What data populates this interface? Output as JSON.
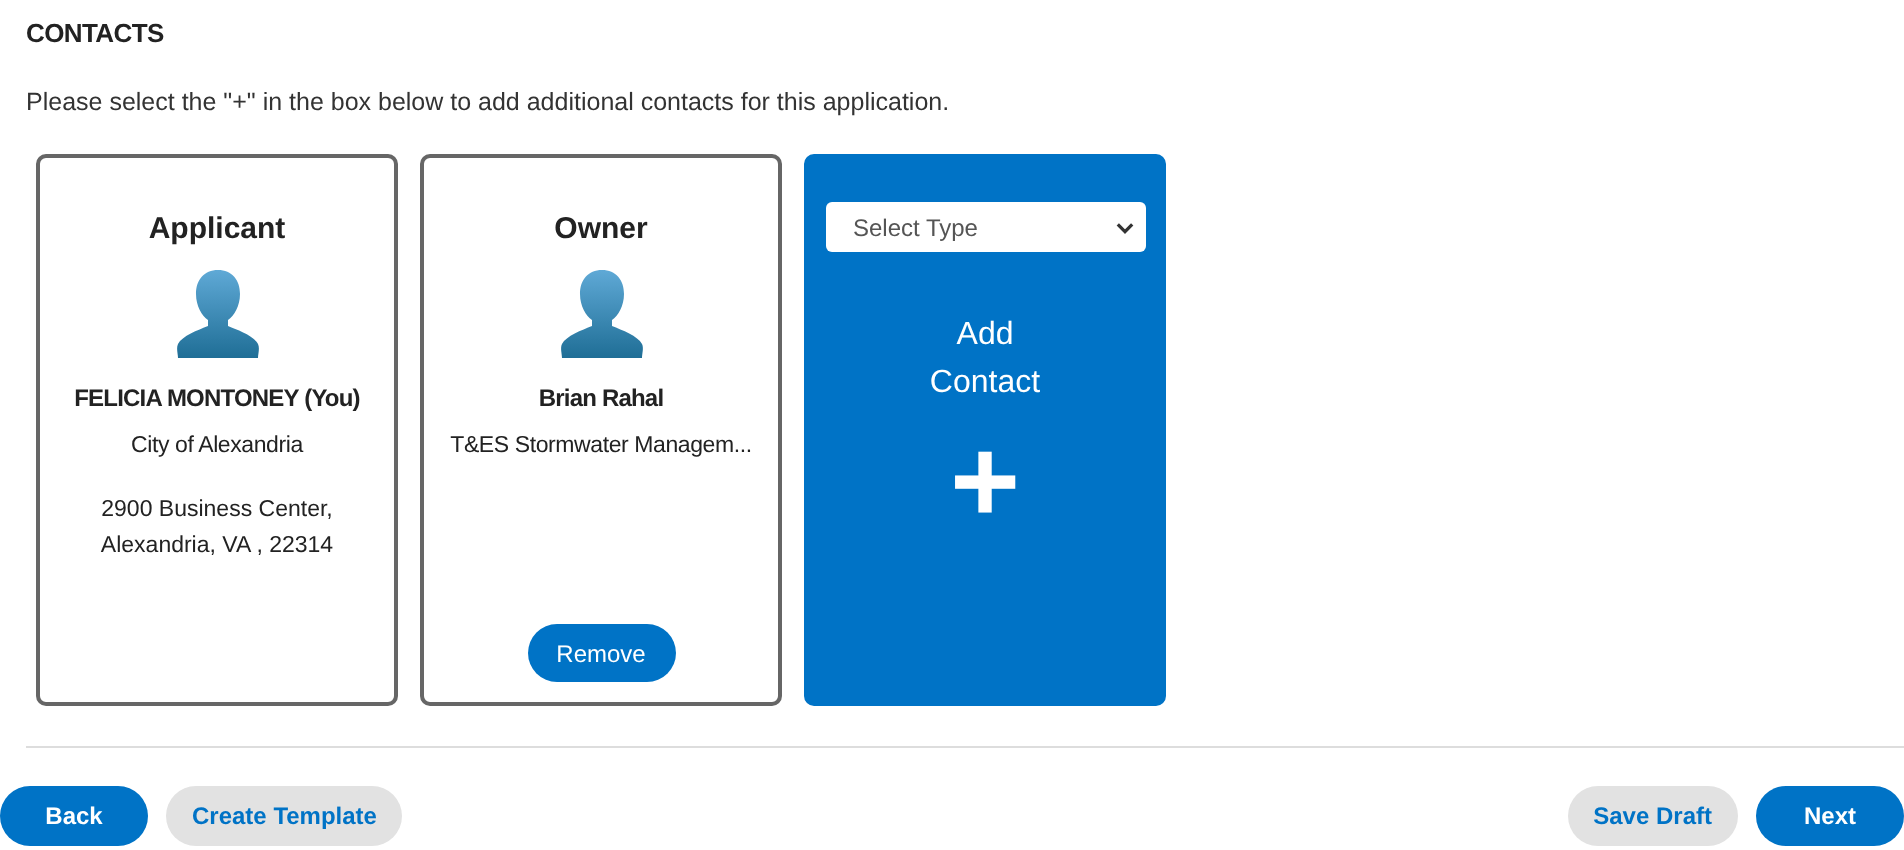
{
  "section_title": "CONTACTS",
  "instruction": "Please select the \"+\" in the box below to add additional contacts for this application.",
  "cards": [
    {
      "kind": "contact",
      "role": "Applicant",
      "name": "FELICIA MONTONEY (You)",
      "organization": "City of Alexandria",
      "address": [
        "2900 Business Center,",
        "Alexandria, VA , 22314"
      ]
    },
    {
      "kind": "contact",
      "role": "Owner",
      "name": "Brian Rahal",
      "organization": "T&ES Stormwater Managem...",
      "button": "Remove"
    },
    {
      "kind": "add",
      "select_placeholder": "Select Type",
      "label": "Add Contact",
      "plus": "+"
    }
  ],
  "footer": {
    "left_buttons": [
      {
        "label": "Back",
        "kind": "primary"
      },
      {
        "label": "Create Template",
        "kind": "secondary"
      }
    ],
    "right_buttons": [
      {
        "label": "Save Draft",
        "kind": "secondary"
      },
      {
        "label": "Next",
        "kind": "primary"
      }
    ]
  }
}
